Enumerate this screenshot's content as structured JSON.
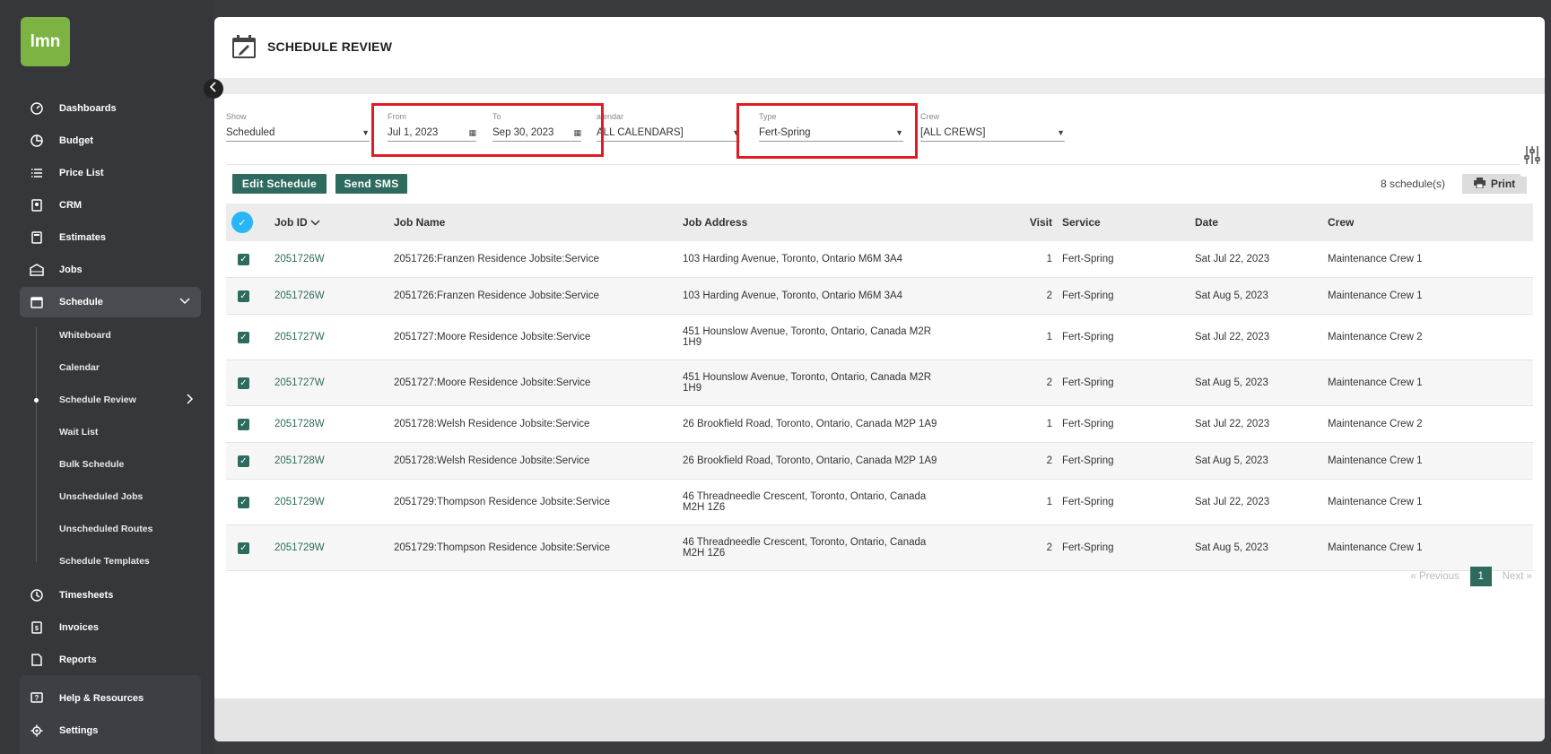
{
  "sidebar": {
    "logo": "lmn",
    "items": [
      {
        "label": "Dashboards",
        "icon": "gauge-icon"
      },
      {
        "label": "Budget",
        "icon": "pie-chart-icon"
      },
      {
        "label": "Price List",
        "icon": "list-icon"
      },
      {
        "label": "CRM",
        "icon": "contact-card-icon"
      },
      {
        "label": "Estimates",
        "icon": "calculator-icon"
      },
      {
        "label": "Jobs",
        "icon": "building-icon"
      },
      {
        "label": "Schedule",
        "icon": "calendar-icon"
      }
    ],
    "schedule_sub": [
      "Whiteboard",
      "Calendar",
      "Schedule Review",
      "Wait List",
      "Bulk Schedule",
      "Unscheduled Jobs",
      "Unscheduled Routes",
      "Schedule Templates"
    ],
    "items_after": [
      {
        "label": "Timesheets",
        "icon": "clock-icon"
      },
      {
        "label": "Invoices",
        "icon": "invoice-icon"
      },
      {
        "label": "Reports",
        "icon": "report-icon"
      }
    ],
    "help": "Help & Resources",
    "settings": "Settings"
  },
  "header": {
    "title": "SCHEDULE REVIEW"
  },
  "filters": {
    "show": {
      "label": "Show",
      "value": "Scheduled"
    },
    "from": {
      "label": "From",
      "value": "Jul 1, 2023"
    },
    "to": {
      "label": "To",
      "value": "Sep 30, 2023"
    },
    "calendar": {
      "label": "alendar",
      "value": "ALL CALENDARS]"
    },
    "type": {
      "label": "Type",
      "value": "Fert-Spring"
    },
    "crew": {
      "label": "Crew",
      "value": "[ALL CREWS]"
    }
  },
  "actions": {
    "edit": "Edit Schedule",
    "sms": "Send SMS",
    "count": "8  schedule(s)",
    "print": "Print"
  },
  "table": {
    "columns": [
      "Job ID",
      "Job Name",
      "Job Address",
      "Visit",
      "Service",
      "Date",
      "Crew"
    ],
    "rows": [
      {
        "id": "2051726W",
        "name": "2051726:Franzen Residence Jobsite:Service",
        "addr1": "103 Harding Avenue, Toronto, Ontario M6M 3A4",
        "addr2": "",
        "visit": "1",
        "service": "Fert-Spring",
        "date": "Sat Jul 22, 2023",
        "crew": "Maintenance Crew 1"
      },
      {
        "id": "2051726W",
        "name": "2051726:Franzen Residence Jobsite:Service",
        "addr1": "103 Harding Avenue, Toronto, Ontario M6M 3A4",
        "addr2": "",
        "visit": "2",
        "service": "Fert-Spring",
        "date": "Sat Aug 5, 2023",
        "crew": "Maintenance Crew 1"
      },
      {
        "id": "2051727W",
        "name": "2051727:Moore Residence Jobsite:Service",
        "addr1": "451 Hounslow Avenue, Toronto, Ontario, Canada M2R",
        "addr2": "1H9",
        "visit": "1",
        "service": "Fert-Spring",
        "date": "Sat Jul 22, 2023",
        "crew": "Maintenance Crew 2"
      },
      {
        "id": "2051727W",
        "name": "2051727:Moore Residence Jobsite:Service",
        "addr1": "451 Hounslow Avenue, Toronto, Ontario, Canada M2R",
        "addr2": "1H9",
        "visit": "2",
        "service": "Fert-Spring",
        "date": "Sat Aug 5, 2023",
        "crew": "Maintenance Crew 1"
      },
      {
        "id": "2051728W",
        "name": "2051728:Welsh Residence Jobsite:Service",
        "addr1": "26 Brookfield Road, Toronto, Ontario, Canada M2P 1A9",
        "addr2": "",
        "visit": "1",
        "service": "Fert-Spring",
        "date": "Sat Jul 22, 2023",
        "crew": "Maintenance Crew 2"
      },
      {
        "id": "2051728W",
        "name": "2051728:Welsh Residence Jobsite:Service",
        "addr1": "26 Brookfield Road, Toronto, Ontario, Canada M2P 1A9",
        "addr2": "",
        "visit": "2",
        "service": "Fert-Spring",
        "date": "Sat Aug 5, 2023",
        "crew": "Maintenance Crew 1"
      },
      {
        "id": "2051729W",
        "name": "2051729:Thompson Residence Jobsite:Service",
        "addr1": "46 Threadneedle Crescent, Toronto, Ontario, Canada",
        "addr2": "M2H 1Z6",
        "visit": "1",
        "service": "Fert-Spring",
        "date": "Sat Jul 22, 2023",
        "crew": "Maintenance Crew 1"
      },
      {
        "id": "2051729W",
        "name": "2051729:Thompson Residence Jobsite:Service",
        "addr1": "46 Threadneedle Crescent, Toronto, Ontario, Canada",
        "addr2": "M2H 1Z6",
        "visit": "2",
        "service": "Fert-Spring",
        "date": "Sat Aug 5, 2023",
        "crew": "Maintenance Crew 1"
      }
    ]
  },
  "pager": {
    "previous": "Previous",
    "page": "1",
    "next": "Next"
  },
  "colors": {
    "accent": "#2e6b5e",
    "logo": "#7cb342",
    "highlight": "#e01b24",
    "select_all": "#29b6f6"
  }
}
